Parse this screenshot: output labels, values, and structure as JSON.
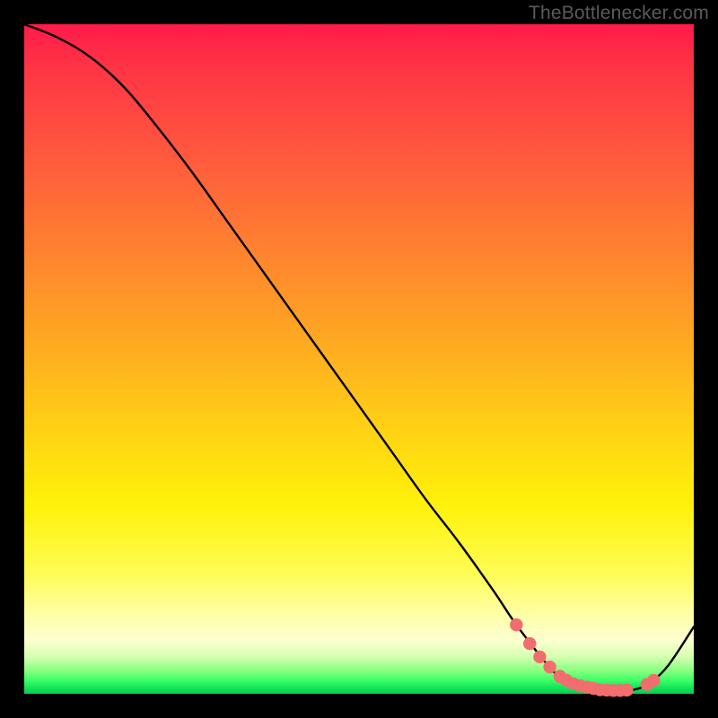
{
  "watermark": "TheBottlenecker.com",
  "colors": {
    "background": "#000000",
    "curve": "#000000",
    "marker_fill": "#f26d6d",
    "marker_stroke": "#d94f4f"
  },
  "chart_data": {
    "type": "line",
    "title": "",
    "xlabel": "",
    "ylabel": "",
    "xlim": [
      0,
      100
    ],
    "ylim": [
      0,
      100
    ],
    "series": [
      {
        "name": "bottleneck-curve",
        "x": [
          0,
          5,
          10,
          15,
          20,
          25,
          30,
          35,
          40,
          45,
          50,
          55,
          60,
          65,
          70,
          73,
          76,
          78,
          80,
          83,
          86,
          89,
          91,
          93,
          96,
          100
        ],
        "y": [
          100,
          98,
          95,
          90.5,
          84.5,
          78,
          71,
          64,
          57,
          50,
          43,
          36,
          29,
          22.5,
          15.5,
          11,
          7,
          4.5,
          2.5,
          1.2,
          0.6,
          0.5,
          0.6,
          1.4,
          4,
          10
        ]
      }
    ],
    "markers": {
      "name": "highlighted-points",
      "x": [
        73.5,
        75.5,
        77,
        78.5,
        80,
        81,
        82,
        83,
        84,
        85,
        86,
        87,
        88,
        89,
        90,
        93,
        94
      ],
      "y": [
        10.3,
        7.5,
        5.5,
        4.0,
        2.6,
        2.0,
        1.5,
        1.2,
        1.0,
        0.8,
        0.6,
        0.55,
        0.5,
        0.5,
        0.55,
        1.4,
        2.0
      ]
    }
  }
}
